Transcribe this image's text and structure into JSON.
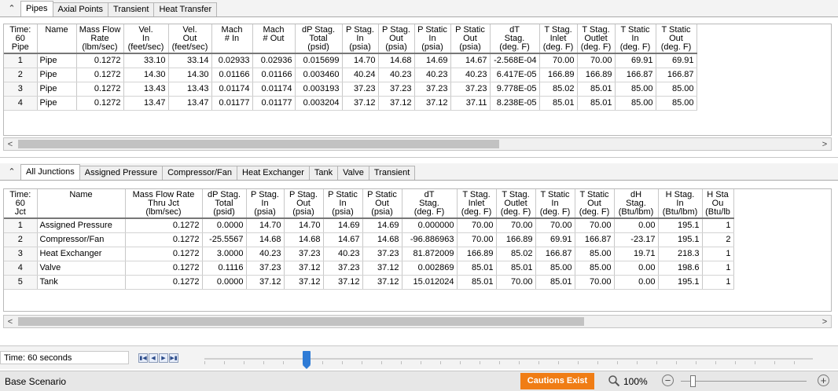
{
  "top_pane": {
    "collapse_glyph": "»",
    "tabs": [
      {
        "label": "Pipes",
        "active": true
      },
      {
        "label": "Axial Points",
        "active": false
      },
      {
        "label": "Transient",
        "active": false
      },
      {
        "label": "Heat Transfer",
        "active": false
      }
    ],
    "table": {
      "headers": [
        "Time:\n60\nPipe",
        "Name",
        "Mass Flow\nRate\n(lbm/sec)",
        "Vel.\nIn\n(feet/sec)",
        "Vel.\nOut\n(feet/sec)",
        "Mach\n# In",
        "Mach\n# Out",
        "dP Stag.\nTotal\n(psid)",
        "P Stag.\nIn\n(psia)",
        "P Stag.\nOut\n(psia)",
        "P Static\nIn\n(psia)",
        "P Static\nOut\n(psia)",
        "dT\nStag.\n(deg. F)",
        "T Stag.\nInlet\n(deg. F)",
        "T Stag.\nOutlet\n(deg. F)",
        "T Static\nIn\n(deg. F)",
        "T Static\nOut\n(deg. F)"
      ],
      "rows": [
        [
          "1",
          "Pipe",
          "0.1272",
          "33.10",
          "33.14",
          "0.02933",
          "0.02936",
          "0.015699",
          "14.70",
          "14.68",
          "14.69",
          "14.67",
          "-2.568E-04",
          "70.00",
          "70.00",
          "69.91",
          "69.91"
        ],
        [
          "2",
          "Pipe",
          "0.1272",
          "14.30",
          "14.30",
          "0.01166",
          "0.01166",
          "0.003460",
          "40.24",
          "40.23",
          "40.23",
          "40.23",
          "6.417E-05",
          "166.89",
          "166.89",
          "166.87",
          "166.87"
        ],
        [
          "3",
          "Pipe",
          "0.1272",
          "13.43",
          "13.43",
          "0.01174",
          "0.01174",
          "0.003193",
          "37.23",
          "37.23",
          "37.23",
          "37.23",
          "9.778E-05",
          "85.02",
          "85.01",
          "85.00",
          "85.00"
        ],
        [
          "4",
          "Pipe",
          "0.1272",
          "13.47",
          "13.47",
          "0.01177",
          "0.01177",
          "0.003204",
          "37.12",
          "37.12",
          "37.12",
          "37.11",
          "8.238E-05",
          "85.01",
          "85.01",
          "85.00",
          "85.00"
        ]
      ]
    }
  },
  "bottom_pane": {
    "collapse_glyph": "»",
    "tabs": [
      {
        "label": "All Junctions",
        "active": true
      },
      {
        "label": "Assigned Pressure",
        "active": false
      },
      {
        "label": "Compressor/Fan",
        "active": false
      },
      {
        "label": "Heat Exchanger",
        "active": false
      },
      {
        "label": "Tank",
        "active": false
      },
      {
        "label": "Valve",
        "active": false
      },
      {
        "label": "Transient",
        "active": false
      }
    ],
    "table": {
      "headers": [
        "Time:\n60\nJct",
        "Name",
        "Mass Flow Rate\nThru Jct\n(lbm/sec)",
        "dP Stag.\nTotal\n(psid)",
        "P Stag.\nIn\n(psia)",
        "P Stag.\nOut\n(psia)",
        "P Static\nIn\n(psia)",
        "P Static\nOut\n(psia)",
        "dT\nStag.\n(deg. F)",
        "T Stag.\nInlet\n(deg. F)",
        "T Stag.\nOutlet\n(deg. F)",
        "T Static\nIn\n(deg. F)",
        "T Static\nOut\n(deg. F)",
        "dH\nStag.\n(Btu/lbm)",
        "H Stag.\nIn\n(Btu/lbm)",
        "H Sta\nOu\n(Btu/lb"
      ],
      "rows": [
        [
          "1",
          "Assigned Pressure",
          "0.1272",
          "0.0000",
          "14.70",
          "14.70",
          "14.69",
          "14.69",
          "0.000000",
          "70.00",
          "70.00",
          "70.00",
          "70.00",
          "0.00",
          "195.1",
          "1"
        ],
        [
          "2",
          "Compressor/Fan",
          "0.1272",
          "-25.5567",
          "14.68",
          "14.68",
          "14.67",
          "14.68",
          "-96.886963",
          "70.00",
          "166.89",
          "69.91",
          "166.87",
          "-23.17",
          "195.1",
          "2"
        ],
        [
          "3",
          "Heat Exchanger",
          "0.1272",
          "3.0000",
          "40.23",
          "37.23",
          "40.23",
          "37.23",
          "81.872009",
          "166.89",
          "85.02",
          "166.87",
          "85.00",
          "19.71",
          "218.3",
          "1"
        ],
        [
          "4",
          "Valve",
          "0.1272",
          "0.1116",
          "37.23",
          "37.12",
          "37.23",
          "37.12",
          "0.002869",
          "85.01",
          "85.01",
          "85.00",
          "85.00",
          "0.00",
          "198.6",
          "1"
        ],
        [
          "5",
          "Tank",
          "0.1272",
          "0.0000",
          "37.12",
          "37.12",
          "37.12",
          "37.12",
          "15.012024",
          "85.01",
          "70.00",
          "85.01",
          "70.00",
          "0.00",
          "195.1",
          "1"
        ]
      ]
    }
  },
  "timebar": {
    "label": "Time: 60 seconds"
  },
  "statusbar": {
    "scenario": "Base Scenario",
    "caution": "Cautions Exist",
    "zoom": "100%"
  },
  "icons": {
    "collapse": "chevron-double-up-icon",
    "scroll_left": "chevron-left-icon",
    "scroll_right": "chevron-right-icon",
    "zoom": "magnifier-icon",
    "zoom_out": "minus-circle-icon",
    "zoom_in": "plus-circle-icon"
  },
  "colors": {
    "caution": "#f07d15",
    "slider_thumb": "#2e7bd6"
  }
}
